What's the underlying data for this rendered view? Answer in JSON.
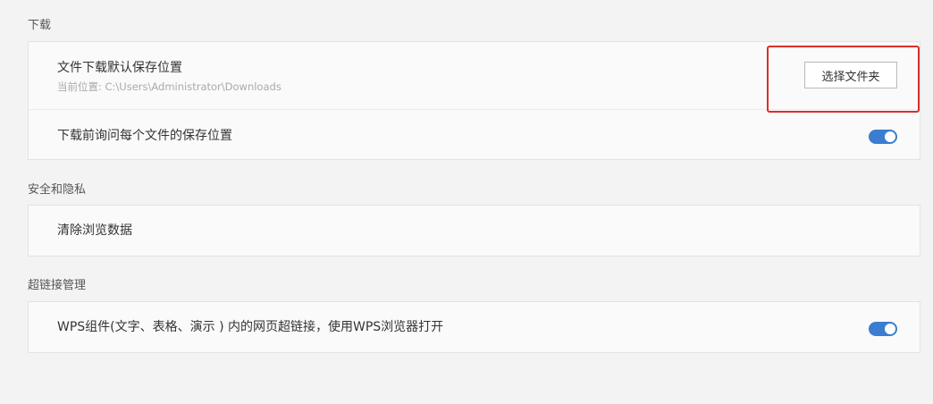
{
  "sections": {
    "download": {
      "title": "下载",
      "default_location_label": "文件下载默认保存位置",
      "current_location": "当前位置: C:\\Users\\Administrator\\Downloads",
      "choose_folder_button": "选择文件夹",
      "ask_each_time_label": "下载前询问每个文件的保存位置",
      "ask_each_time_enabled": true
    },
    "privacy": {
      "title": "安全和隐私",
      "clear_data_label": "清除浏览数据"
    },
    "hyperlink": {
      "title": "超链接管理",
      "wps_links_label": "WPS组件(文字、表格、演示 ) 内的网页超链接，使用WPS浏览器打开",
      "wps_links_enabled": true
    }
  },
  "colors": {
    "toggle_on": "#3a7dd1",
    "highlight": "#d9302c",
    "background": "#f3f3f3"
  }
}
